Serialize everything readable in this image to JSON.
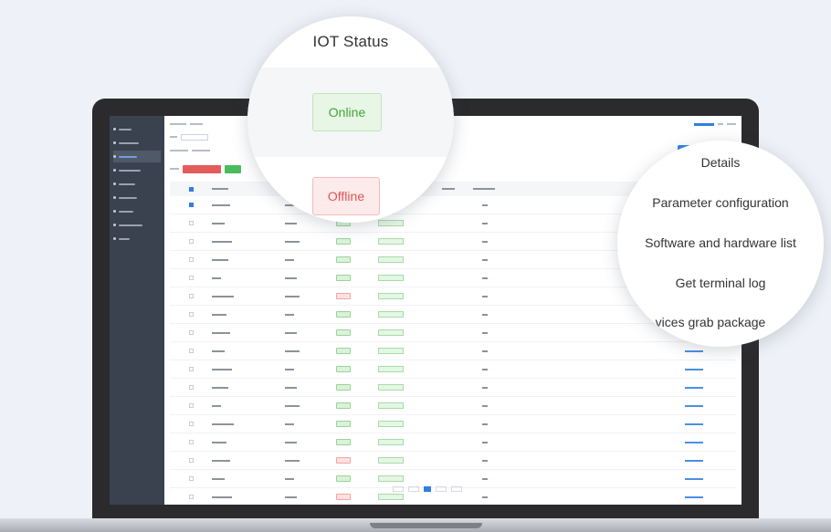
{
  "iot_panel": {
    "title": "IOT Status",
    "online_label": "Online",
    "offline_label": "Offline"
  },
  "action_menu": {
    "items": [
      "Details",
      "Parameter configuration",
      "Software and hardware list",
      "Get terminal log",
      "vices grab package"
    ]
  },
  "colors": {
    "online": "#3fa33a",
    "offline": "#e05656",
    "accent": "#2f7fe0",
    "sidebar": "#3a4250"
  },
  "table": {
    "row_status": [
      "ok",
      "ok",
      "ok",
      "ok",
      "ok",
      "bad",
      "ok",
      "ok",
      "ok",
      "ok",
      "ok",
      "ok",
      "ok",
      "ok",
      "bad",
      "ok",
      "bad"
    ]
  }
}
